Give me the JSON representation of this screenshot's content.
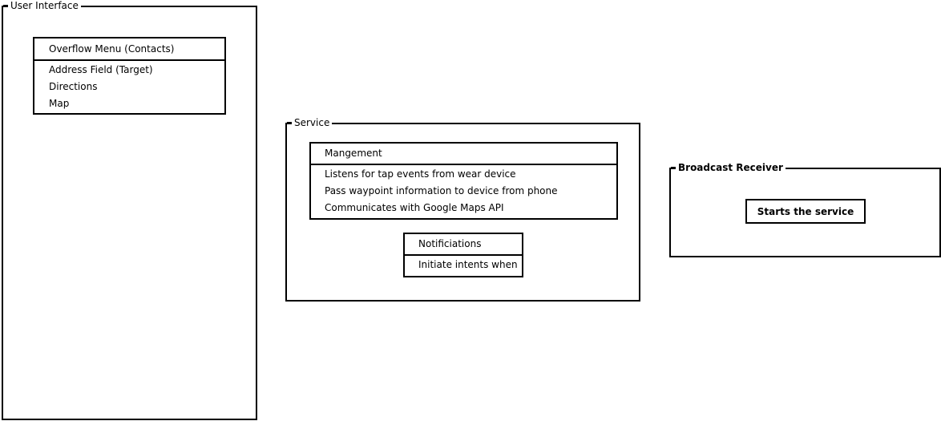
{
  "user_interface": {
    "title": "User Interface",
    "menu": {
      "header": "Overflow Menu (Contacts)",
      "items": [
        "Address Field (Target)",
        "Directions",
        "Map"
      ]
    }
  },
  "service": {
    "title": "Service",
    "management": {
      "header": "Mangement",
      "items": [
        "Listens for tap events from wear device",
        "Pass waypoint information to device from phone",
        "Communicates with Google  Maps API"
      ]
    },
    "notifications": {
      "header": "Notificiations",
      "items": [
        "Initiate intents when"
      ]
    }
  },
  "broadcast_receiver": {
    "title": "Broadcast Receiver",
    "button_label": "Starts the service"
  }
}
